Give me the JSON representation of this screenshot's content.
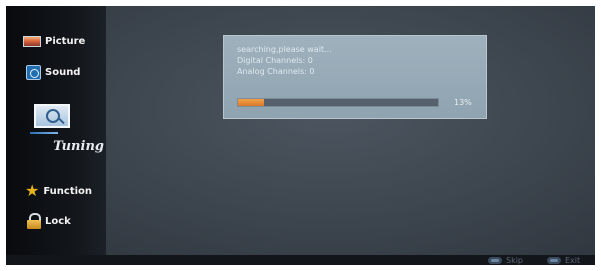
{
  "sidebar": {
    "items": [
      {
        "label": "Picture",
        "icon": "picture-icon"
      },
      {
        "label": "Sound",
        "icon": "sound-icon"
      },
      {
        "label": "Tuning",
        "icon": "tuning-icon",
        "selected": true
      },
      {
        "label": "Function",
        "icon": "star-icon"
      },
      {
        "label": "Lock",
        "icon": "lock-icon"
      }
    ]
  },
  "dialog": {
    "status": "searching,please wait...",
    "digital": "Digital Channels: 0",
    "analog": "Analog Channels: 0",
    "progress_text": "13%",
    "progress_fraction": 0.13
  },
  "footer": {
    "skip": "Skip",
    "exit": "Exit"
  },
  "colors": {
    "progress": "#e28a35",
    "background": "#3f4750",
    "sidebar": "#0e1115"
  }
}
